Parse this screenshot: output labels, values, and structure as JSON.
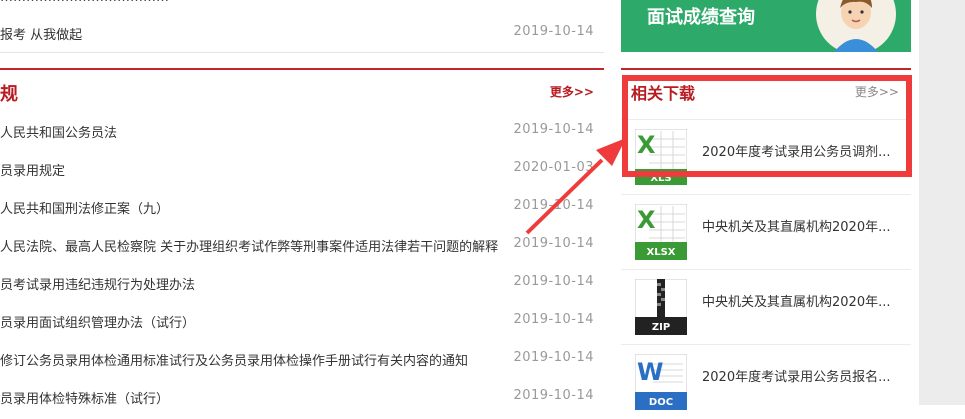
{
  "top_news": {
    "partial_title": "…………………………………",
    "row": {
      "title": "报考   从我做起",
      "date": "2019-10-14"
    }
  },
  "laws": {
    "heading": "规",
    "more": "更多>>",
    "items": [
      {
        "title": "人民共和国公务员法",
        "date": "2019-10-14"
      },
      {
        "title": "员录用规定",
        "date": "2020-01-03"
      },
      {
        "title": "人民共和国刑法修正案（九）",
        "date": "2019-10-14"
      },
      {
        "title": "人民法院、最高人民检察院 关于办理组织考试作弊等刑事案件适用法律若干问题的解释",
        "date": "2019-10-14"
      },
      {
        "title": "员考试录用违纪违规行为处理办法",
        "date": "2019-10-14"
      },
      {
        "title": "员录用面试组织管理办法（试行）",
        "date": "2019-10-14"
      },
      {
        "title": "修订公务员录用体检通用标准试行及公务员录用体检操作手册试行有关内容的通知",
        "date": "2019-10-14"
      },
      {
        "title": "员录用体检特殊标准（试行）",
        "date": "2019-10-14"
      }
    ]
  },
  "exam_banner": {
    "label": "面试成绩查询"
  },
  "downloads": {
    "heading": "相关下载",
    "more": "更多>>",
    "items": [
      {
        "name": "2020年度考试录用公务员调剂...",
        "type": "XLS"
      },
      {
        "name": "中央机关及其直属机构2020年...",
        "type": "XLSX"
      },
      {
        "name": "中央机关及其直属机构2020年...",
        "type": "ZIP"
      },
      {
        "name": "2020年度考试录用公务员报名...",
        "type": "DOC"
      }
    ]
  },
  "colors": {
    "accent_red": "#c0262d",
    "banner_green": "#2daa6a",
    "annotation_red": "#ef3b3b"
  }
}
